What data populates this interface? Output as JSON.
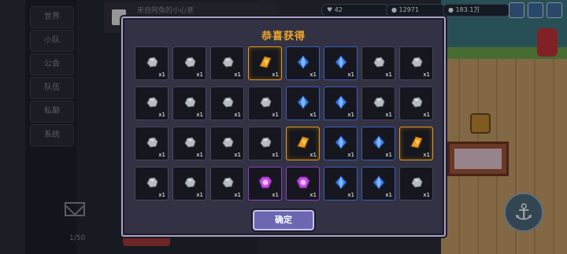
{
  "background": {
    "chat_tabs": [
      "世界",
      "小队",
      "公会",
      "队伍",
      "私聊",
      "系统"
    ],
    "chat_message": "来自阿兔的小心意",
    "message_count": "1/50",
    "resources": [
      {
        "icon": "heart-icon",
        "value": "42"
      },
      {
        "icon": "coin-icon",
        "value": "12971"
      },
      {
        "icon": "gold-coin-icon",
        "value": "183.1万"
      }
    ]
  },
  "dialog": {
    "title": "恭喜获得",
    "confirm_label": "确定",
    "rows": [
      [
        {
          "item": "stone",
          "qty": "x1"
        },
        {
          "item": "stone",
          "qty": "x1"
        },
        {
          "item": "stone",
          "qty": "x1"
        },
        {
          "item": "gold-scroll",
          "qty": "x1"
        },
        {
          "item": "blue-gem",
          "qty": "x1"
        },
        {
          "item": "blue-gem",
          "qty": "x1"
        },
        {
          "item": "stone",
          "qty": "x1"
        },
        {
          "item": "stone",
          "qty": "x1"
        }
      ],
      [
        {
          "item": "stone",
          "qty": "x1"
        },
        {
          "item": "stone",
          "qty": "x1"
        },
        {
          "item": "stone",
          "qty": "x1"
        },
        {
          "item": "stone",
          "qty": "x1"
        },
        {
          "item": "blue-gem",
          "qty": "x1"
        },
        {
          "item": "blue-gem",
          "qty": "x1"
        },
        {
          "item": "stone",
          "qty": "x1"
        },
        {
          "item": "stone",
          "qty": "x1"
        }
      ],
      [
        {
          "item": "stone",
          "qty": "x1"
        },
        {
          "item": "stone",
          "qty": "x1"
        },
        {
          "item": "stone",
          "qty": "x1"
        },
        {
          "item": "stone",
          "qty": "x1"
        },
        {
          "item": "gold-scroll",
          "qty": "x1"
        },
        {
          "item": "blue-gem",
          "qty": "x1"
        },
        {
          "item": "blue-gem",
          "qty": "x1"
        },
        {
          "item": "gold-scroll",
          "qty": "x1"
        }
      ],
      [
        {
          "item": "stone",
          "qty": "x1"
        },
        {
          "item": "stone",
          "qty": "x1"
        },
        {
          "item": "stone",
          "qty": "x1"
        },
        {
          "item": "purple-gem",
          "qty": "x1"
        },
        {
          "item": "purple-gem",
          "qty": "x1"
        },
        {
          "item": "blue-gem",
          "qty": "x1"
        },
        {
          "item": "blue-gem",
          "qty": "x1"
        },
        {
          "item": "stone",
          "qty": "x1"
        }
      ]
    ]
  },
  "colors": {
    "title": "#f1a72a",
    "gold_border": "#e2961c",
    "blue_border": "#3c5fb8",
    "purple_border": "#8a3fc7",
    "confirm_bg": "#6b67b0"
  }
}
